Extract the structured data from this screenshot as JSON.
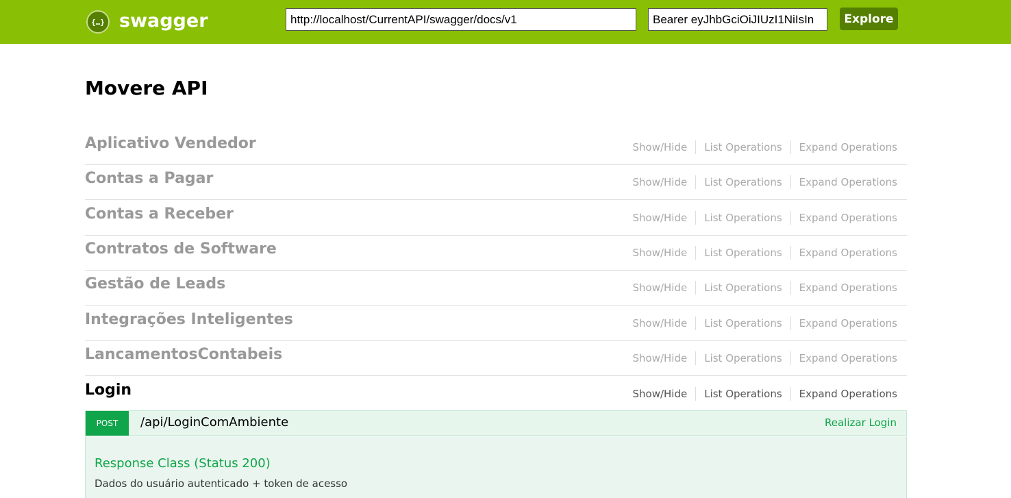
{
  "header": {
    "logo_icon": "{…}",
    "logo_text": "swagger",
    "url_value": "http://localhost/CurrentAPI/swagger/docs/v1",
    "api_key_value": "Bearer eyJhbGciOiJIUzI1NiIsIn",
    "explore_label": "Explore",
    "brand_color": "#89bf04",
    "dark_color": "#547f00"
  },
  "api": {
    "title": "Movere API"
  },
  "resources": [
    {
      "name": "Aplicativo Vendedor",
      "show_hide": "Show/Hide",
      "list_ops": "List Operations",
      "expand_ops": "Expand Operations"
    },
    {
      "name": "Contas a Pagar",
      "show_hide": "Show/Hide",
      "list_ops": "List Operations",
      "expand_ops": "Expand Operations"
    },
    {
      "name": "Contas a Receber",
      "show_hide": "Show/Hide",
      "list_ops": "List Operations",
      "expand_ops": "Expand Operations"
    },
    {
      "name": "Contratos de Software",
      "show_hide": "Show/Hide",
      "list_ops": "List Operations",
      "expand_ops": "Expand Operations"
    },
    {
      "name": "Gestão de Leads",
      "show_hide": "Show/Hide",
      "list_ops": "List Operations",
      "expand_ops": "Expand Operations"
    },
    {
      "name": "Integrações Inteligentes",
      "show_hide": "Show/Hide",
      "list_ops": "List Operations",
      "expand_ops": "Expand Operations"
    },
    {
      "name": "LancamentosContabeis",
      "show_hide": "Show/Hide",
      "list_ops": "List Operations",
      "expand_ops": "Expand Operations"
    },
    {
      "name": "Login",
      "show_hide": "Show/Hide",
      "list_ops": "List Operations",
      "expand_ops": "Expand Operations"
    }
  ],
  "endpoint": {
    "method": "POST",
    "path": "/api/LoginComAmbiente",
    "summary": "Realizar Login",
    "method_color": "#10a54a",
    "response_title": "Response Class (Status 200)",
    "response_desc": "Dados do usuário autenticado + token de acesso"
  }
}
